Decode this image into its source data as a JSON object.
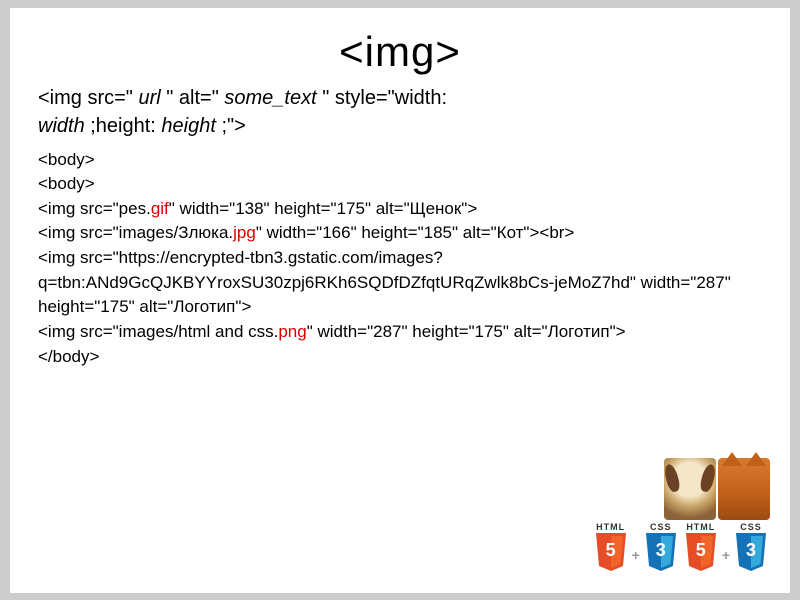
{
  "title": "<img>",
  "syntax": {
    "p1": "<img src=\"",
    "url": " url ",
    "p2": "\" alt=\"",
    "alt": " some_text ",
    "p3": "\" style=\"width:",
    "width": "width ",
    "p4": ";height:",
    "height": " height ",
    "p5": ";\">"
  },
  "code": {
    "l1": "<body>",
    "l2": "<body>",
    "l3a": "<img src=\"pes.",
    "l3ext": "gif",
    "l3b": "\" width=\"138\" height=\"175\" alt=\"Щенок\">",
    "l4a": "<img src=\"images/Злюка.",
    "l4ext": "jpg",
    "l4b": "\" width=\"166\" height=\"185\" alt=\"Кот\"><br>",
    "l5": "<img src=\"https://encrypted-tbn3.gstatic.com/images?q=tbn:ANd9GcQJKBYYroxSU30zpj6RKh6SQDfDZfqtURqZwlk8bCs-jeMoZ7hd\" width=\"287\" height=\"175\" alt=\"Логотип\">",
    "l6a": "<img src=\"images/html and css.",
    "l6ext": "png",
    "l6b": "\" width=\"287\" height=\"175\" alt=\"Логотип\">",
    "l7": "</body>"
  },
  "badges": {
    "html": "HTML",
    "css": "CSS",
    "five": "5",
    "three": "3"
  }
}
